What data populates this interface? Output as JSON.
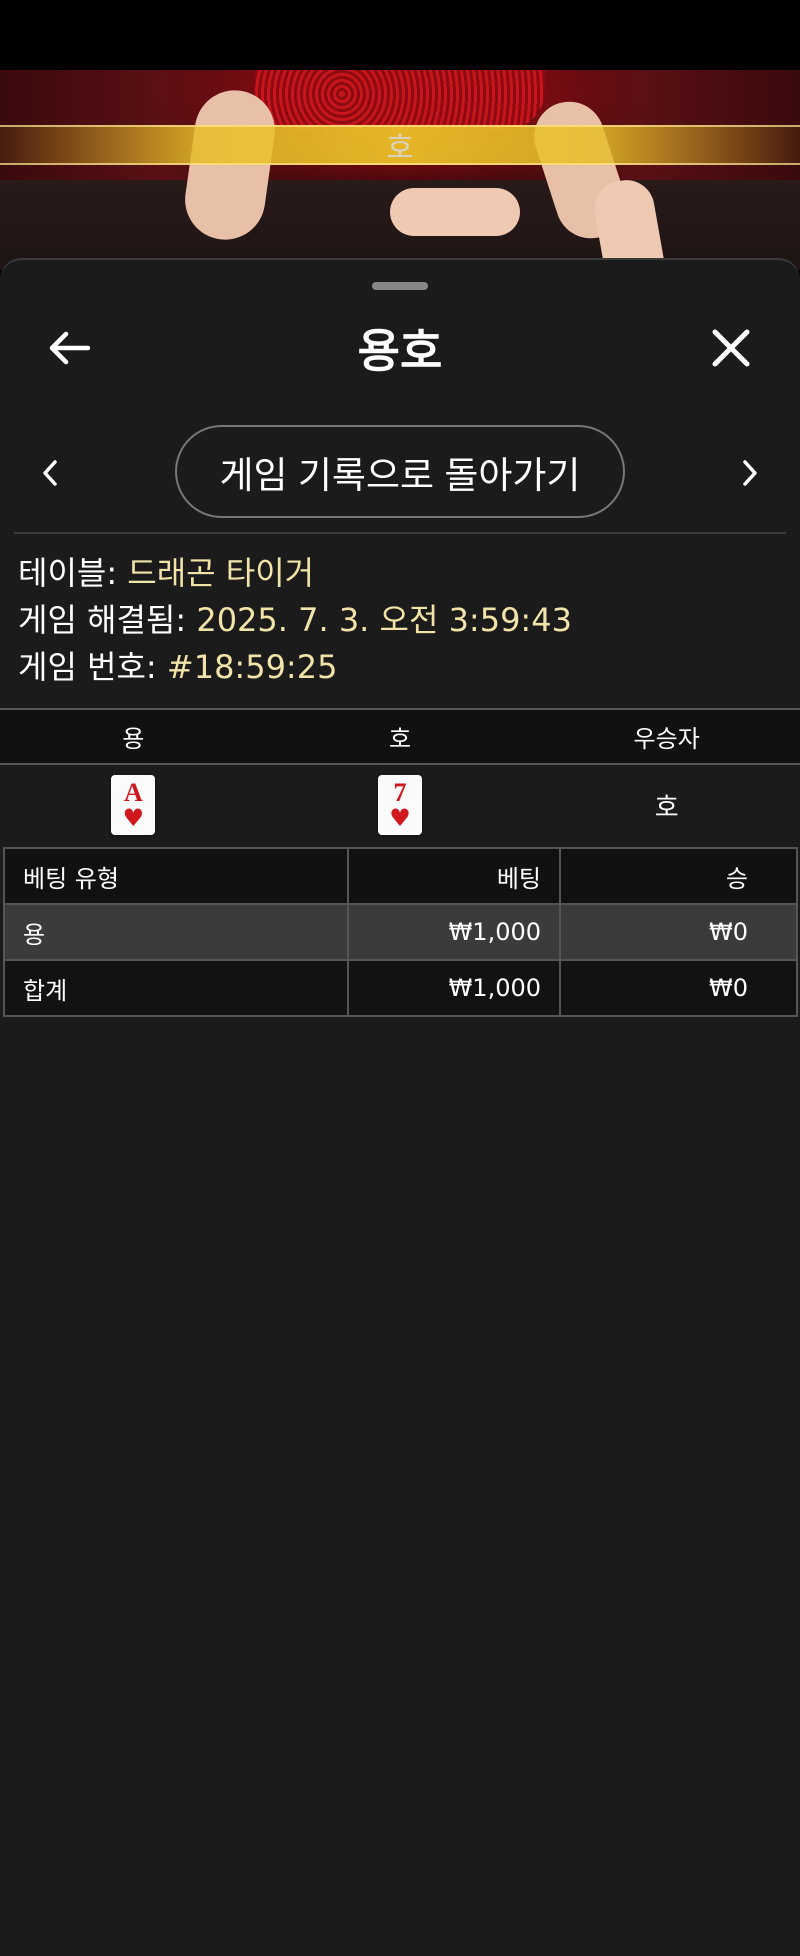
{
  "video": {
    "banner_text": "호"
  },
  "header": {
    "title": "용호"
  },
  "nav": {
    "back_to_history_label": "게임 기록으로 돌아가기"
  },
  "info": {
    "table_label": "테이블:",
    "table_value": "드래곤 타이거",
    "resolved_label": "게임 해결됨:",
    "resolved_value": "2025. 7. 3. 오전 3:59:43",
    "game_number_label": "게임 번호:",
    "game_number_value": "#18:59:25"
  },
  "result": {
    "columns": [
      "용",
      "호",
      "우승자"
    ],
    "dragon_card": {
      "rank": "A",
      "suit": "♥"
    },
    "tiger_card": {
      "rank": "7",
      "suit": "♥"
    },
    "winner": "호"
  },
  "bets": {
    "columns": [
      "베팅 유형",
      "베팅",
      "승"
    ],
    "rows": [
      {
        "type": "용",
        "bet": "₩1,000",
        "win": "₩0"
      },
      {
        "type": "합계",
        "bet": "₩1,000",
        "win": "₩0"
      }
    ]
  },
  "colors": {
    "accent_value": "#f2e3a8",
    "card_red": "#d1171e",
    "sheet_bg": "#1b1b1b"
  },
  "icons": [
    "arrow-left-icon",
    "close-icon",
    "chevron-left-icon",
    "chevron-right-icon",
    "heart-suit-icon"
  ]
}
